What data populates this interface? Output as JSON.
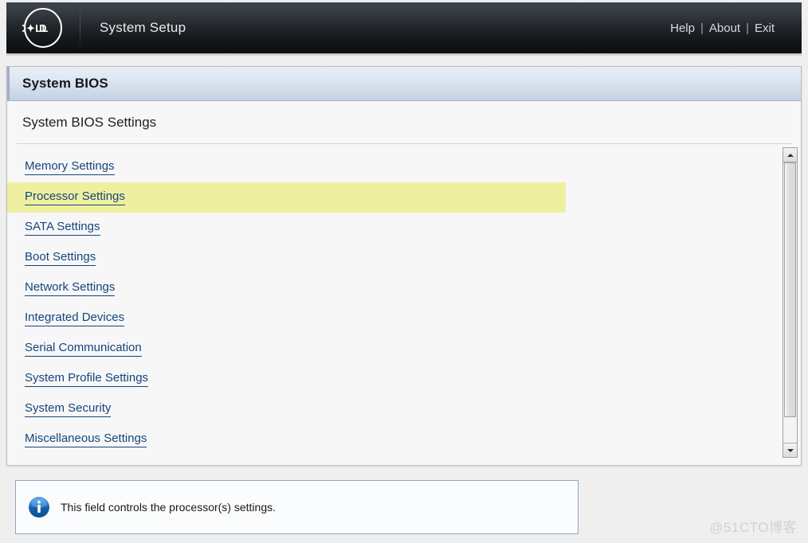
{
  "titlebar": {
    "logo_text": "DELL",
    "logo_icon": "dell-oval-logo",
    "app_title": "System Setup",
    "links": [
      {
        "label": "Help",
        "name": "help-link"
      },
      {
        "label": "About",
        "name": "about-link"
      },
      {
        "label": "Exit",
        "name": "exit-link"
      }
    ],
    "separator": "|"
  },
  "panel": {
    "header_title": "System BIOS",
    "subheader_title": "System BIOS Settings"
  },
  "menu": {
    "items": [
      {
        "label": "Memory Settings",
        "selected": false
      },
      {
        "label": "Processor Settings",
        "selected": true
      },
      {
        "label": "SATA Settings",
        "selected": false
      },
      {
        "label": "Boot Settings",
        "selected": false
      },
      {
        "label": "Network Settings",
        "selected": false
      },
      {
        "label": "Integrated Devices",
        "selected": false
      },
      {
        "label": "Serial Communication",
        "selected": false
      },
      {
        "label": "System Profile Settings",
        "selected": false
      },
      {
        "label": "System Security",
        "selected": false
      },
      {
        "label": "Miscellaneous Settings",
        "selected": false
      }
    ]
  },
  "scrollbar": {
    "up_icon": "triangle-up-icon",
    "down_icon": "triangle-down-icon"
  },
  "infobox": {
    "icon": "info-circle-icon",
    "text": "This field controls the processor(s) settings."
  },
  "watermark": {
    "text": "@51CTO博客"
  },
  "colors": {
    "highlight": "#eff09f",
    "link": "#14457c",
    "titlebar_dark": "#0c0e0f",
    "panel_header_blue": "#ccd9e8",
    "info_icon_blue": "#1b6fc4",
    "page_background": "#efefef"
  }
}
